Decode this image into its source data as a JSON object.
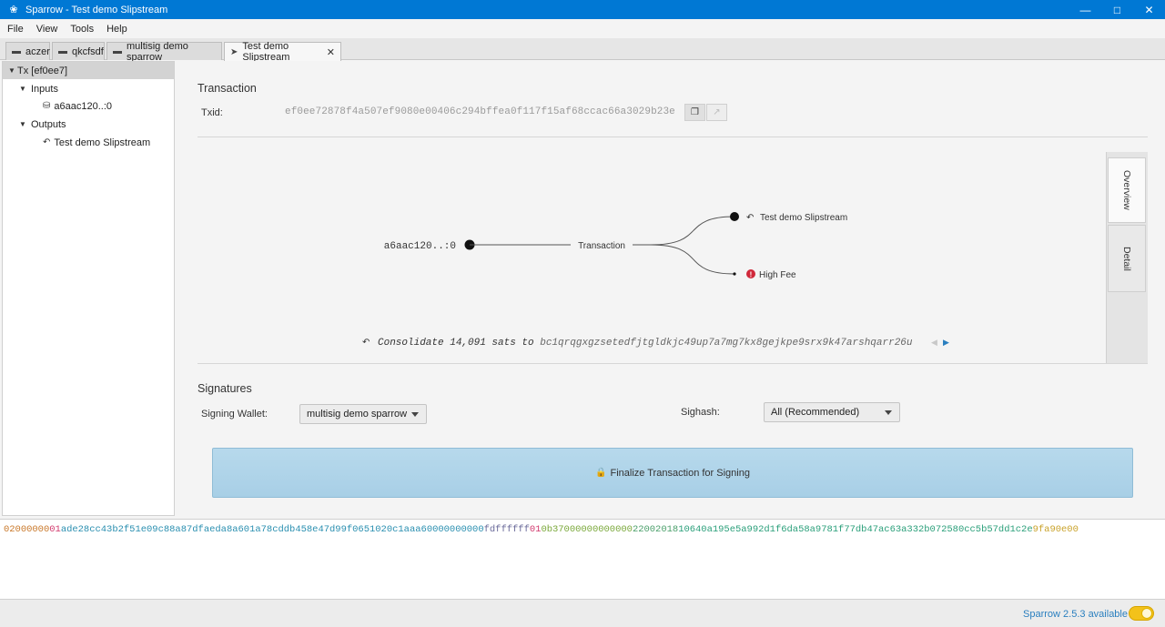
{
  "window": {
    "title": "Sparrow - Test demo Slipstream"
  },
  "menu": {
    "items": [
      "File",
      "View",
      "Tools",
      "Help"
    ]
  },
  "tabs": [
    {
      "label": "aczer",
      "icon": "wallet-icon"
    },
    {
      "label": "qkcfsdf",
      "icon": "wallet-icon"
    },
    {
      "label": "multisig demo sparrow",
      "icon": "wallet-icon"
    },
    {
      "label": "Test demo Slipstream",
      "icon": "send-icon",
      "active": true
    }
  ],
  "tree": {
    "root": "Tx [ef0ee7]",
    "inputs_label": "Inputs",
    "input_item": "a6aac120..:0",
    "outputs_label": "Outputs",
    "output_item": "Test demo Slipstream"
  },
  "transaction": {
    "title": "Transaction",
    "txid_label": "Txid:",
    "txid": "ef0ee72878f4a507ef9080e00406c294bffea0f117f15af68ccac66a3029b23e"
  },
  "diagram": {
    "input": "a6aac120..:0",
    "center": "Transaction",
    "output1": "Test demo Slipstream",
    "output2": "High Fee",
    "consolidate_prefix": "Consolidate 14,091 sats to ",
    "address": "bc1qrqgxgzsetedfjtgldkjc49up7a7mg7kx8gejkpe9srx9k47arshqarr26u",
    "side_tabs": [
      "Overview",
      "Detail"
    ]
  },
  "signatures": {
    "title": "Signatures",
    "signing_wallet_label": "Signing Wallet:",
    "signing_wallet_value": "multisig demo sparrow",
    "sighash_label": "Sighash:",
    "sighash_value": "All (Recommended)",
    "finalize_label": "Finalize Transaction for Signing"
  },
  "hex": [
    {
      "text": "02000000",
      "color": "#c9782a"
    },
    {
      "text": "01",
      "color": "#d23a6e"
    },
    {
      "text": "ade28cc43b2f51e09c88a87dfaeda8a601a78cddb458e47d99f0651020c1aaa6",
      "color": "#2a8fb0"
    },
    {
      "text": "0000000000",
      "color": "#2a8fb0"
    },
    {
      "text": "fdffffff",
      "color": "#6a6a9a"
    },
    {
      "text": "01",
      "color": "#d23a6e"
    },
    {
      "text": "0b37000000000000",
      "color": "#7aa83a"
    },
    {
      "text": "22002018",
      "color": "#4a9f6a"
    },
    {
      "text": "10640a195e5a992d1f6da58a9781f77db47ac63a332b072580cc5b57dd1c2e",
      "color": "#2a9f7a"
    },
    {
      "text": "9fa90e00",
      "color": "#c9a22a"
    }
  ],
  "status": {
    "update_text": "Sparrow 2.5.3 available"
  },
  "colors": {
    "titlebar": "#0078d4",
    "finalize": "#b7d9ec",
    "toggle": "#f3c21a",
    "high_fee": "#d0283a"
  }
}
